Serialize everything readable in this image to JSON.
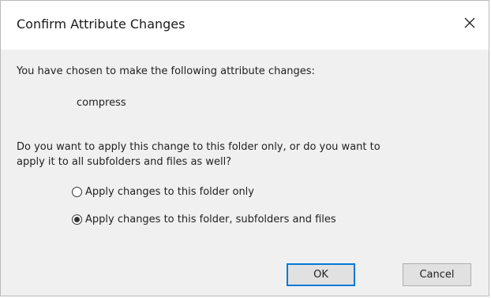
{
  "dialog": {
    "title": "Confirm Attribute Changes",
    "close_icon": "close-icon",
    "intro_text": "You have chosen to make the following attribute changes:",
    "attribute": "compress",
    "question_line1": "Do you want to apply this change to this folder only, or do you want to",
    "question_line2": "apply it to all subfolders and files as well?",
    "options": [
      {
        "label": "Apply changes to this folder only",
        "selected": false
      },
      {
        "label": "Apply changes to this folder, subfolders and files",
        "selected": true
      }
    ],
    "ok_label": "OK",
    "cancel_label": "Cancel"
  },
  "colors": {
    "client_background": "#f0f0f0",
    "default_button_border": "#0078d7",
    "button_background": "#e1e1e1"
  }
}
